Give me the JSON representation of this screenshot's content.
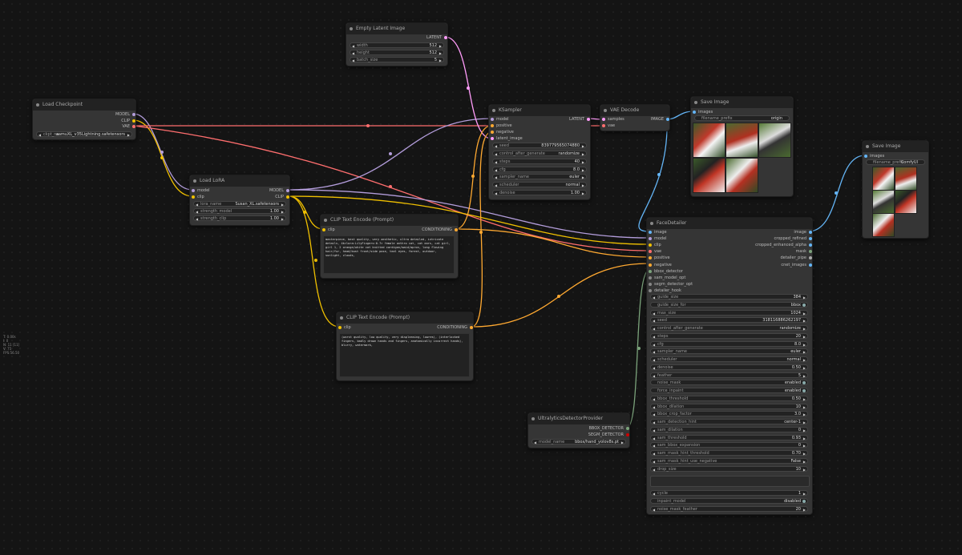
{
  "stats": [
    "T: 0.00s",
    "I: 0",
    "N: 11 [11]",
    "V: 75",
    "FPS:56.50"
  ],
  "colors": {
    "model": "#b39ddb",
    "clip": "#f0c000",
    "vae": "#ff6e6e",
    "latent": "#ff9cf9",
    "conditioning": "#ffa931",
    "image": "#64b5f6",
    "bbox": "#7ba37b"
  },
  "nodes": {
    "load_checkpoint": {
      "title": "Load Checkpoint",
      "outputs": [
        "MODEL",
        "CLIP",
        "VAE"
      ],
      "ckpt_label": "ckpt_na",
      "ckpt_value": "aamuXL_v35Lightning.safetensors"
    },
    "empty_latent": {
      "title": "Empty Latent Image",
      "output": "LATENT",
      "widgets": [
        {
          "label": "width",
          "value": "512"
        },
        {
          "label": "height",
          "value": "512"
        },
        {
          "label": "batch_size",
          "value": "5"
        }
      ]
    },
    "load_lora": {
      "title": "Load LoRA",
      "inputs": [
        "model",
        "clip"
      ],
      "outputs": [
        "MODEL",
        "CLIP"
      ],
      "widgets": [
        {
          "label": "lora_name",
          "value": "Susan_XL.safetensors"
        },
        {
          "label": "strength_model",
          "value": "1.00"
        },
        {
          "label": "strength_clip",
          "value": "1.00"
        }
      ]
    },
    "clip_pos": {
      "title": "CLIP Text Encode (Prompt)",
      "input": "clip",
      "output": "CONDITIONING",
      "text": "masterpiece, best quality, very aesthetic, ultra detailed, intricate details, 4k<lora:LilyFingers:0.7> female anthro cat, cat ears, cat girl, girl 1, 2 orange/white cat knitted cardigan/maid/apron, long flowing hair/fur, head/bust front/side pose, teal eyes, forest, outdoor, sunlight, clouds,"
    },
    "clip_neg": {
      "title": "CLIP Text Encode (Prompt)",
      "input": "clip",
      "output": "CONDITIONING",
      "text": "(worst quality, low quality, very displeasing, lowres), (interlocked fingers, badly drawn hands and fingers, anatomically incorrect hands), blurry, watermark,"
    },
    "ksampler": {
      "title": "KSampler",
      "inputs": [
        "model",
        "positive",
        "negative",
        "latent_image"
      ],
      "output": "LATENT",
      "widgets": [
        {
          "label": "seed",
          "value": "839779565074880"
        },
        {
          "label": "control_after_generate",
          "value": "randomize"
        },
        {
          "label": "steps",
          "value": "40"
        },
        {
          "label": "cfg",
          "value": "8.0"
        },
        {
          "label": "sampler_name",
          "value": "euler"
        },
        {
          "label": "scheduler",
          "value": "normal"
        },
        {
          "label": "denoise",
          "value": "1.00"
        }
      ]
    },
    "vae_decode": {
      "title": "VAE Decode",
      "inputs": [
        "samples",
        "vae"
      ],
      "output": "IMAGE"
    },
    "save1": {
      "title": "Save Image",
      "input": "images",
      "prefix_label": "filename_prefix",
      "prefix_value": "origin"
    },
    "save2": {
      "title": "Save Image",
      "input": "images",
      "prefix_label": "filename_prefix",
      "prefix_value": "ComfyUI"
    },
    "ultra": {
      "title": "UltralyticsDetectorProvider",
      "outputs": [
        "BBOX_DETECTOR",
        "SEGM_DETECTOR"
      ],
      "model_label": "model_name",
      "model_value": "bbox/hand_yolov8s.pt"
    },
    "face": {
      "title": "FaceDetailer",
      "inputs": [
        "image",
        "model",
        "clip",
        "vae",
        "positive",
        "negative",
        "bbox_detector",
        "sam_model_opt",
        "segm_detector_opt",
        "detailer_hook"
      ],
      "outputs": [
        "image",
        "cropped_refined",
        "cropped_enhanced_alpha",
        "mask",
        "detailer_pipe",
        "cnet_images"
      ],
      "widgets": [
        {
          "label": "guide_size",
          "value": "384",
          "kind": "num"
        },
        {
          "label": "guide_size_for",
          "value": "bbox",
          "kind": "toggle"
        },
        {
          "label": "max_size",
          "value": "1024",
          "kind": "num"
        },
        {
          "label": "seed",
          "value": "318116886262197",
          "kind": "num"
        },
        {
          "label": "control_after_generate",
          "value": "randomize",
          "kind": "num"
        },
        {
          "label": "steps",
          "value": "20",
          "kind": "num"
        },
        {
          "label": "cfg",
          "value": "8.0",
          "kind": "num"
        },
        {
          "label": "sampler_name",
          "value": "euler",
          "kind": "num"
        },
        {
          "label": "scheduler",
          "value": "normal",
          "kind": "num"
        },
        {
          "label": "denoise",
          "value": "0.50",
          "kind": "num"
        },
        {
          "label": "feather",
          "value": "5",
          "kind": "num"
        },
        {
          "label": "noise_mask",
          "value": "enabled",
          "kind": "toggle"
        },
        {
          "label": "force_inpaint",
          "value": "enabled",
          "kind": "toggle"
        },
        {
          "label": "bbox_threshold",
          "value": "0.50",
          "kind": "num"
        },
        {
          "label": "bbox_dilation",
          "value": "10",
          "kind": "num"
        },
        {
          "label": "bbox_crop_factor",
          "value": "3.0",
          "kind": "num"
        },
        {
          "label": "sam_detection_hint",
          "value": "center-1",
          "kind": "num"
        },
        {
          "label": "sam_dilation",
          "value": "0",
          "kind": "num"
        },
        {
          "label": "sam_threshold",
          "value": "0.93",
          "kind": "num"
        },
        {
          "label": "sam_bbox_expansion",
          "value": "0",
          "kind": "num"
        },
        {
          "label": "sam_mask_hint_threshold",
          "value": "0.70",
          "kind": "num"
        },
        {
          "label": "sam_mask_hint_use_negative",
          "value": "False",
          "kind": "num"
        },
        {
          "label": "drop_size",
          "value": "10",
          "kind": "num"
        }
      ],
      "widgets2": [
        {
          "label": "cycle",
          "value": "1",
          "kind": "num"
        },
        {
          "label": "inpaint_model",
          "value": "disabled",
          "kind": "toggle"
        },
        {
          "label": "noise_mask_feather",
          "value": "20",
          "kind": "num"
        }
      ]
    }
  }
}
